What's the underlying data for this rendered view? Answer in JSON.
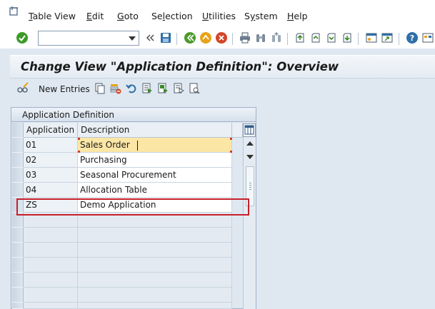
{
  "menu": {
    "items": [
      {
        "label": "Table View",
        "u": "T",
        "rest": "able View"
      },
      {
        "label": "Edit",
        "u": "E",
        "rest": "dit"
      },
      {
        "label": "Goto",
        "u": "G",
        "rest": "oto"
      },
      {
        "label": "Selection",
        "pre": "Se",
        "u": "l",
        "rest": "ection"
      },
      {
        "label": "Utilities",
        "u": "U",
        "rest": "tilities"
      },
      {
        "label": "System",
        "pre": "S",
        "u": "y",
        "rest": "stem"
      },
      {
        "label": "Help",
        "u": "H",
        "rest": "elp"
      }
    ]
  },
  "toolbar": {
    "command_value": ""
  },
  "title": {
    "text": "Change View \"Application Definition\": Overview"
  },
  "app_toolbar": {
    "new_entries_label": "New Entries"
  },
  "table": {
    "title": "Application Definition",
    "columns": [
      "Application",
      "Description"
    ],
    "rows": [
      {
        "application": "01",
        "description": "Sales Order"
      },
      {
        "application": "02",
        "description": "Purchasing"
      },
      {
        "application": "03",
        "description": "Seasonal Procurement"
      },
      {
        "application": "04",
        "description": "Allocation Table"
      },
      {
        "application": "ZS",
        "description": "Demo Application"
      }
    ]
  },
  "colors": {
    "highlight": "#c8202a",
    "focus_cell": "#fbe6a6",
    "accent": "#2f6fa8"
  }
}
